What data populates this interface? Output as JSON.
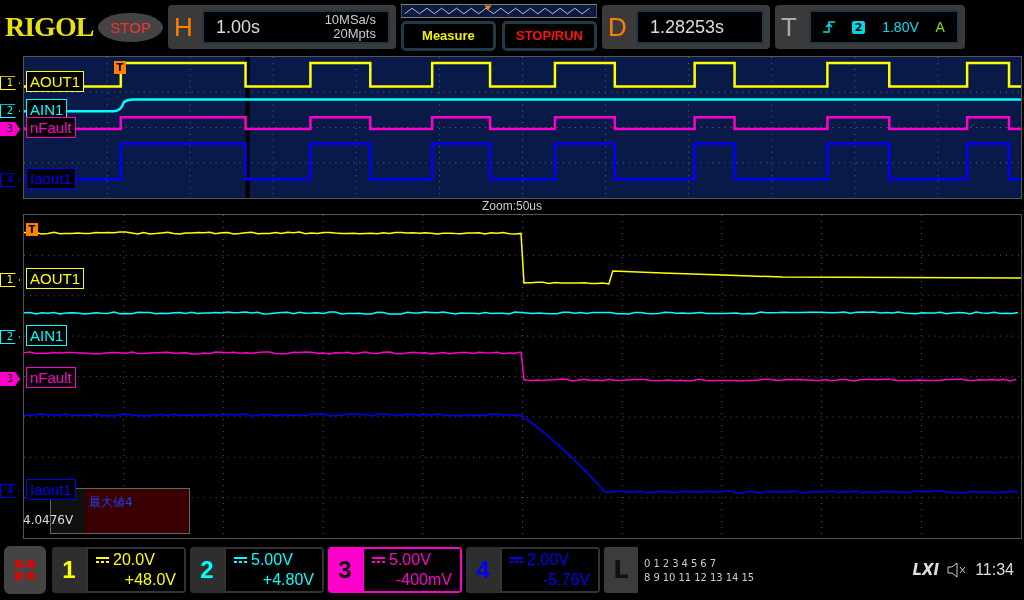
{
  "header": {
    "brand": "RIGOL",
    "run_state": "STOP",
    "horizontal": {
      "letter": "H",
      "timebase": "1.00s",
      "sample_rate": "10MSa/s",
      "memory_depth": "20Mpts"
    },
    "measure_button": "Measure",
    "stop_run_button": "STOP/RUN",
    "delay": {
      "letter": "D",
      "value": "1.28253s"
    },
    "trigger": {
      "letter": "T",
      "source": "2",
      "level": "1.80V",
      "mode": "A"
    }
  },
  "overview": {
    "trigger_marker": "T",
    "traces": [
      {
        "number": "1",
        "label": "AOUT1",
        "color": "#ffff00",
        "selected": false
      },
      {
        "number": "2",
        "label": "AIN1",
        "color": "#00ffff",
        "selected": false
      },
      {
        "number": "3",
        "label": "nFault",
        "color": "#ff00cc",
        "selected": true
      },
      {
        "number": "4",
        "label": "Iaout1",
        "color": "#0000ff",
        "selected": false
      }
    ]
  },
  "zoom_label": "Zoom:50us",
  "main": {
    "trigger_marker": "T",
    "traces": [
      {
        "number": "1",
        "label": "AOUT1",
        "color": "#ffff00",
        "selected": false
      },
      {
        "number": "2",
        "label": "AIN1",
        "color": "#00ffff",
        "selected": false
      },
      {
        "number": "3",
        "label": "nFault",
        "color": "#ff00cc",
        "selected": true
      },
      {
        "number": "4",
        "label": "Iaout1",
        "color": "#0000ff",
        "selected": false
      }
    ],
    "measurement": {
      "name": "最大値4",
      "value": "4.0476V"
    }
  },
  "channels": [
    {
      "number": "1",
      "scale": "20.0V",
      "offset": "+48.0V",
      "color": "#ffff00",
      "selected": false
    },
    {
      "number": "2",
      "scale": "5.00V",
      "offset": "+4.80V",
      "color": "#00ffff",
      "selected": false
    },
    {
      "number": "3",
      "scale": "5.00V",
      "offset": "-400mV",
      "color": "#ff00cc",
      "selected": true
    },
    {
      "number": "4",
      "scale": "2.00V",
      "offset": "-5.76V",
      "color": "#0000ff",
      "selected": false
    }
  ],
  "logic": {
    "letter": "L",
    "row_1": [
      "0",
      "1",
      "2",
      "3",
      "4",
      "5",
      "6",
      "7"
    ],
    "row_2": [
      "8",
      "9",
      "10",
      "11",
      "12",
      "13",
      "14",
      "15"
    ]
  },
  "status": {
    "lxi": "LXI",
    "time": "11:34"
  }
}
